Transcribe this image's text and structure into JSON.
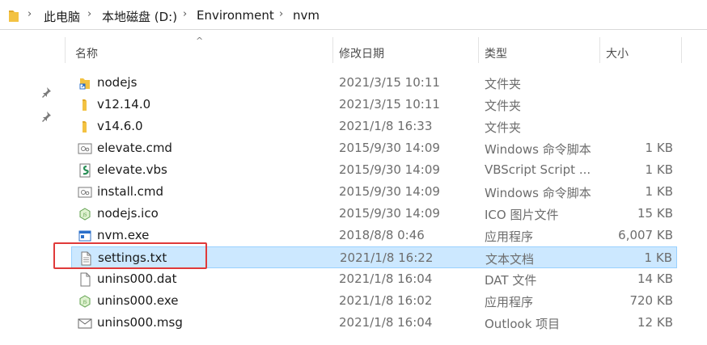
{
  "address": {
    "crumbs": [
      "此电脑",
      "本地磁盘 (D:)",
      "Environment",
      "nvm"
    ],
    "separator": "›"
  },
  "columns": {
    "name": "名称",
    "date": "修改日期",
    "type": "类型",
    "size": "大小"
  },
  "files": [
    {
      "name": "nodejs",
      "date": "2021/3/15 10:11",
      "type": "文件夹",
      "size": "",
      "icon": "folder-shortcut-icon"
    },
    {
      "name": "v12.14.0",
      "date": "2021/3/15 10:11",
      "type": "文件夹",
      "size": "",
      "icon": "folder-icon"
    },
    {
      "name": "v14.6.0",
      "date": "2021/1/8 16:33",
      "type": "文件夹",
      "size": "",
      "icon": "folder-icon"
    },
    {
      "name": "elevate.cmd",
      "date": "2015/9/30 14:09",
      "type": "Windows 命令脚本",
      "size": "1 KB",
      "icon": "cmd-script-icon"
    },
    {
      "name": "elevate.vbs",
      "date": "2015/9/30 14:09",
      "type": "VBScript Script ...",
      "size": "1 KB",
      "icon": "vbs-script-icon"
    },
    {
      "name": "install.cmd",
      "date": "2015/9/30 14:09",
      "type": "Windows 命令脚本",
      "size": "1 KB",
      "icon": "cmd-script-icon"
    },
    {
      "name": "nodejs.ico",
      "date": "2015/9/30 14:09",
      "type": "ICO 图片文件",
      "size": "15 KB",
      "icon": "nodejs-icon"
    },
    {
      "name": "nvm.exe",
      "date": "2018/8/8 0:46",
      "type": "应用程序",
      "size": "6,007 KB",
      "icon": "exe-window-icon"
    },
    {
      "name": "settings.txt",
      "date": "2021/1/8 16:22",
      "type": "文本文档",
      "size": "1 KB",
      "icon": "text-file-icon",
      "selected": true
    },
    {
      "name": "unins000.dat",
      "date": "2021/1/8 16:04",
      "type": "DAT 文件",
      "size": "14 KB",
      "icon": "blank-file-icon"
    },
    {
      "name": "unins000.exe",
      "date": "2021/1/8 16:02",
      "type": "应用程序",
      "size": "720 KB",
      "icon": "nodejs-icon"
    },
    {
      "name": "unins000.msg",
      "date": "2021/1/8 16:04",
      "type": "Outlook 项目",
      "size": "12 KB",
      "icon": "mail-icon"
    }
  ],
  "colors": {
    "selection_bg": "#cce8ff",
    "selection_border": "#99d1ff",
    "highlight_box": "#e03a3a",
    "folder": "#f3c242"
  }
}
